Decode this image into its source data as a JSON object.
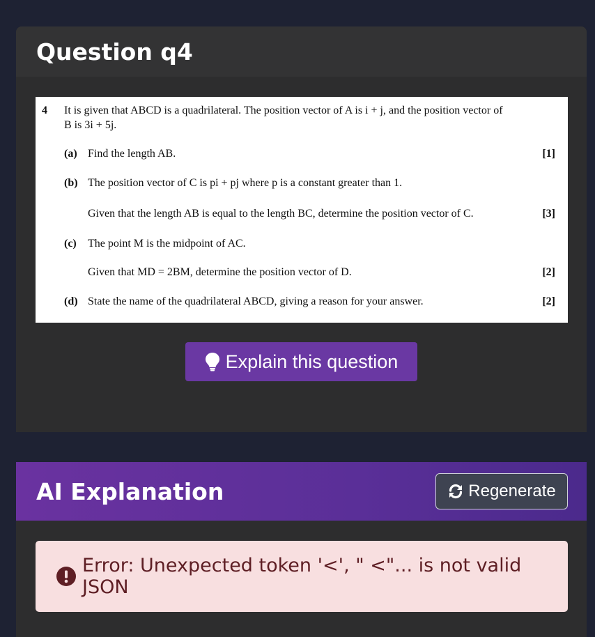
{
  "question_card": {
    "title": "Question q4",
    "question": {
      "number": "4",
      "intro_line1": "It is given that ABCD is a quadrilateral. The position vector of A is i + j, and the position vector of",
      "intro_line2": "B is 3i + 5j.",
      "part_a_label": "(a)",
      "part_a_text": "Find the length AB.",
      "part_a_marks": "[1]",
      "part_b_label": "(b)",
      "part_b_text": "The position vector of C is pi + pj where p is a constant greater than 1.",
      "part_b_text2": "Given that the length AB is equal to the length BC, determine the position vector of C.",
      "part_b_marks": "[3]",
      "part_c_label": "(c)",
      "part_c_text": "The point M is the midpoint of AC.",
      "part_c_text2": "Given that MD = 2BM, determine the position vector of D.",
      "part_c_marks": "[2]",
      "part_d_label": "(d)",
      "part_d_text": "State the name of the quadrilateral ABCD, giving a reason for your answer.",
      "part_d_marks": "[2]"
    },
    "explain_button": "Explain this question",
    "explain_icon": "lightbulb-icon"
  },
  "ai_card": {
    "title": "AI Explanation",
    "regenerate_button": "Regenerate",
    "regenerate_icon": "sync-icon",
    "error_message": "Error: Unexpected token '<', \" <\"... is not valid JSON",
    "error_icon": "exclamation-circle-icon"
  },
  "colors": {
    "background": "#1e2233",
    "card": "#2d2d2e",
    "accent_purple": "#6a38a3",
    "error_bg": "#f8dfe0",
    "error_text": "#5e1e24"
  }
}
